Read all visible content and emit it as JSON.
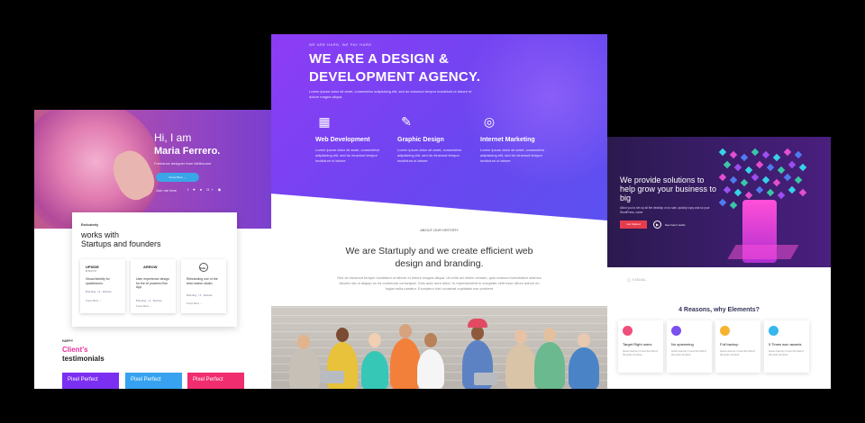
{
  "left": {
    "hi": "Hi, I am",
    "name": "Maria Ferrero.",
    "subtitle": "Freelance designer from Melbourne",
    "button": "Know More →",
    "join": "Join me here",
    "social": "f ♥ ● G+ ◉",
    "card": {
      "kicker": "Exclusively",
      "title_line1": "works with",
      "title_line2": "Startups and founders",
      "items": [
        {
          "logo": "UPSIDE",
          "logo_sub": "N M O O",
          "text": "Visual Identity for upsidedown.",
          "meta": "Branding , UI , Website",
          "more": "Know More →"
        },
        {
          "logo": "ARROW",
          "logo_sub": "",
          "text": "User experience design for the AI powered Bot App",
          "meta": "Branding , UI , Website",
          "more": "Know More →"
        },
        {
          "logo": "Cab.",
          "logo_sub": "",
          "text": "Rebranding one of the best motion studio.",
          "meta": "Branding , UI , Website",
          "more": "Know More →"
        }
      ]
    },
    "happy": "HAPPY",
    "clients": "Client's",
    "testimonials": "testimonials",
    "pills": [
      {
        "label": "Pixel Perfect",
        "color": "#7b2ff0"
      },
      {
        "label": "Pixel Perfect",
        "color": "#37a3f0"
      },
      {
        "label": "Pixel Perfect",
        "color": "#ef2d6f"
      }
    ]
  },
  "mid": {
    "tag": "WE ARE HARD, WE PAY HARD",
    "headline1": "WE ARE A DESIGN &",
    "headline2": "DEVELOPMENT AGENCY.",
    "intro": "Lorem ipsum dolor sit amet, consectetur adipisicing elit, sed do eiusmod tempor incididunt ut labore et dolore magna aliqua.",
    "services": [
      {
        "icon": "server-icon",
        "glyph": "▦",
        "title": "Web Development",
        "desc": "Lorem ipsum dolor sit amet, consectetur adipisicing elit, sed do eiusmod tempor incididunt ut labore"
      },
      {
        "icon": "pen-tool-icon",
        "glyph": "✎",
        "title": "Graphic Design",
        "desc": "Lorem ipsum dolor sit amet, consectetur adipisicing elit, sed do eiusmod tempor incididunt ut labore"
      },
      {
        "icon": "target-icon",
        "glyph": "◎",
        "title": "Internet Marketing",
        "desc": "Lorem ipsum dolor sit amet, consectetur adipisicing elit, sed do eiusmod tempor incididunt ut labore"
      }
    ],
    "about": "ABOUT OUR HISTORY",
    "statement_line1": "We are Startuply and we create efficient web",
    "statement_line2": "design and branding.",
    "paragraph": "Sed do eiusmod tempor incididunt ut labore et dolore magna aliqua. Ut enim ad minim veniam, quis nostrud exercitation ullamco laboris nisi ut aliquip ex ea commodo consequat. Duis aute irure dolor. In reprehenderit in voluptate velit esse cillum dolore eu fugiat nulla pariatur. Excepteur sint occaecat cupidatat non proident"
  },
  "right": {
    "headline": "We provide solutions to help grow your business to big",
    "small": "Allow you to set up all the desktop on to sale, quickly copy and so your WordPress, name",
    "button": "Get Started",
    "time": "See how it works",
    "brand": "◯ VISUAL",
    "reasons": "4 Reasons, why Elements?",
    "features": [
      {
        "title": "Target Right users",
        "desc": "Ipsum dummy in text the fold of the dolor sit amet",
        "color": "#ef4f7a"
      },
      {
        "title": "No spamming",
        "desc": "Ipsum dummy in text the fold of the dolor sit amet",
        "color": "#7b4ff0"
      },
      {
        "title": "Full backup",
        "desc": "Ipsum dummy in text the fold of the dolor sit amet",
        "color": "#f5b331"
      },
      {
        "title": "5 Times won awards",
        "desc": "Ipsum dummy in text the fold of the dolor sit amet",
        "color": "#37b6f0"
      }
    ]
  }
}
